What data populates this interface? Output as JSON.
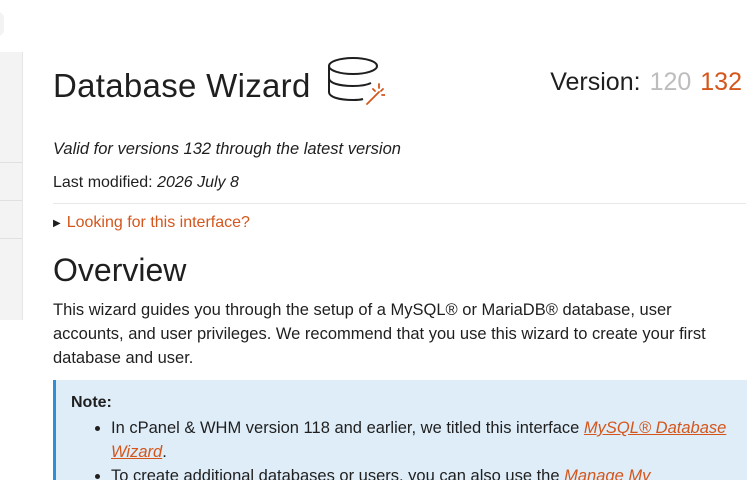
{
  "page": {
    "title": "Database Wizard",
    "title_icon": "database-wand-icon",
    "version_label": "Version:",
    "version_old": "120",
    "version_current": "132",
    "valid_for": "Valid for versions 132 through the latest version",
    "modified_label": "Last modified:",
    "modified_date": "2026 July 8",
    "details_summary": "Looking for this interface?"
  },
  "overview": {
    "heading": "Overview",
    "paragraph": "This wizard guides you through the setup of a MySQL® or MariaDB® database, user accounts, and user privileges. We recommend that you use this wizard to create your first database and user."
  },
  "note": {
    "title": "Note:",
    "item1_text": "In cPanel & WHM version 118 and earlier, we titled this interface ",
    "item1_link": "MySQL® Database Wizard",
    "item1_end": ".",
    "item2_text": "To create additional databases or users, you can also use the ",
    "item2_link": "Manage My"
  },
  "colors": {
    "accent": "#d4561c",
    "note_bg": "#deedf8",
    "note_border": "#2e8fd6",
    "muted_version": "#bdbdbd"
  }
}
